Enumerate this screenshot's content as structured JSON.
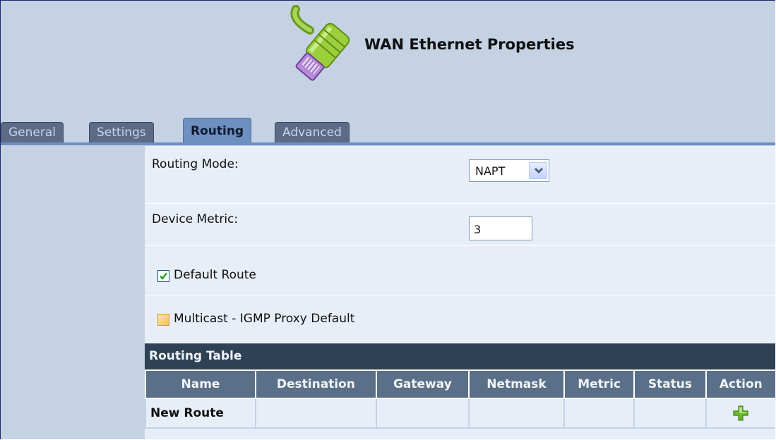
{
  "page": {
    "title": "WAN Ethernet Properties",
    "icon": "ethernet-cable-icon"
  },
  "tabs": [
    {
      "label": "General",
      "active": false
    },
    {
      "label": "Settings",
      "active": false
    },
    {
      "label": "Routing",
      "active": true
    },
    {
      "label": "Advanced",
      "active": false
    }
  ],
  "form": {
    "routing_mode": {
      "label": "Routing Mode:",
      "value": "NAPT"
    },
    "device_metric": {
      "label": "Device Metric:",
      "value": "3"
    },
    "default_route": {
      "label": "Default Route",
      "checked": true
    },
    "multicast": {
      "label": "Multicast - IGMP Proxy Default",
      "checked": false
    }
  },
  "routing_table": {
    "title": "Routing Table",
    "columns": [
      "Name",
      "Destination",
      "Gateway",
      "Netmask",
      "Metric",
      "Status",
      "Action"
    ],
    "rows": [
      {
        "name": "New Route",
        "destination": "",
        "gateway": "",
        "netmask": "",
        "metric": "",
        "status": "",
        "action_icon": "add-icon"
      }
    ]
  },
  "colors": {
    "header_bg": "#c4d2e4",
    "panel_bg": "#e8eef7",
    "table_title_bg": "#2e4155",
    "table_header_bg": "#5a7088",
    "active_tab": "#6e90c0",
    "inactive_tab": "#5d6b86"
  }
}
